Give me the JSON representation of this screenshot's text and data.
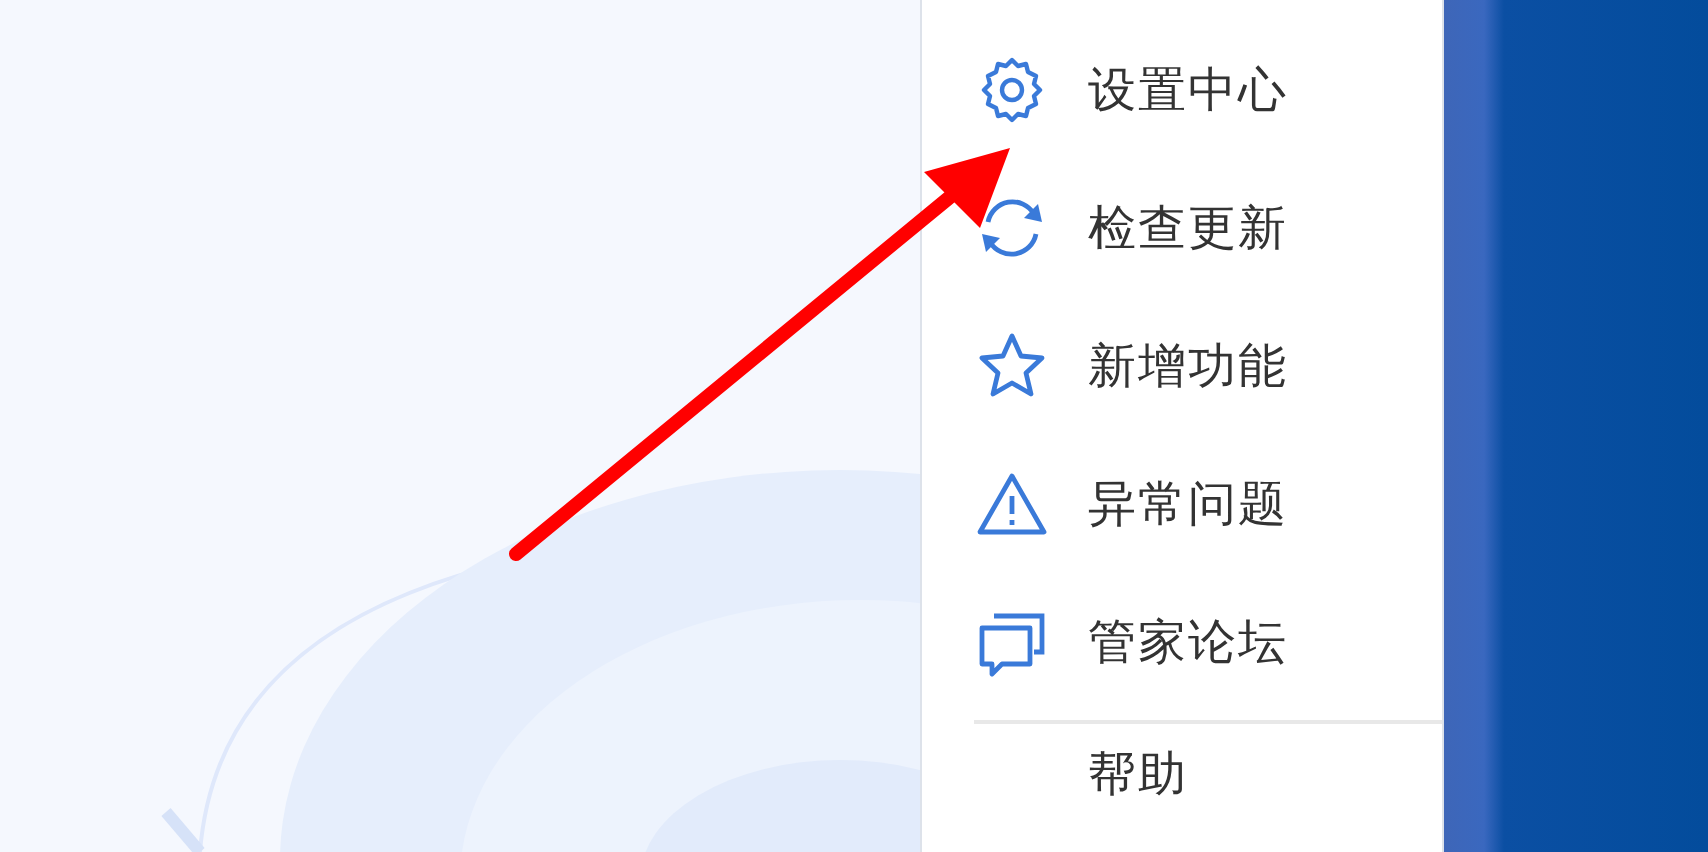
{
  "menu": {
    "items": [
      {
        "label": "设置中心"
      },
      {
        "label": "检查更新"
      },
      {
        "label": "新增功能"
      },
      {
        "label": "异常问题"
      },
      {
        "label": "管家论坛"
      }
    ],
    "footer_item": {
      "label": "帮助"
    }
  }
}
